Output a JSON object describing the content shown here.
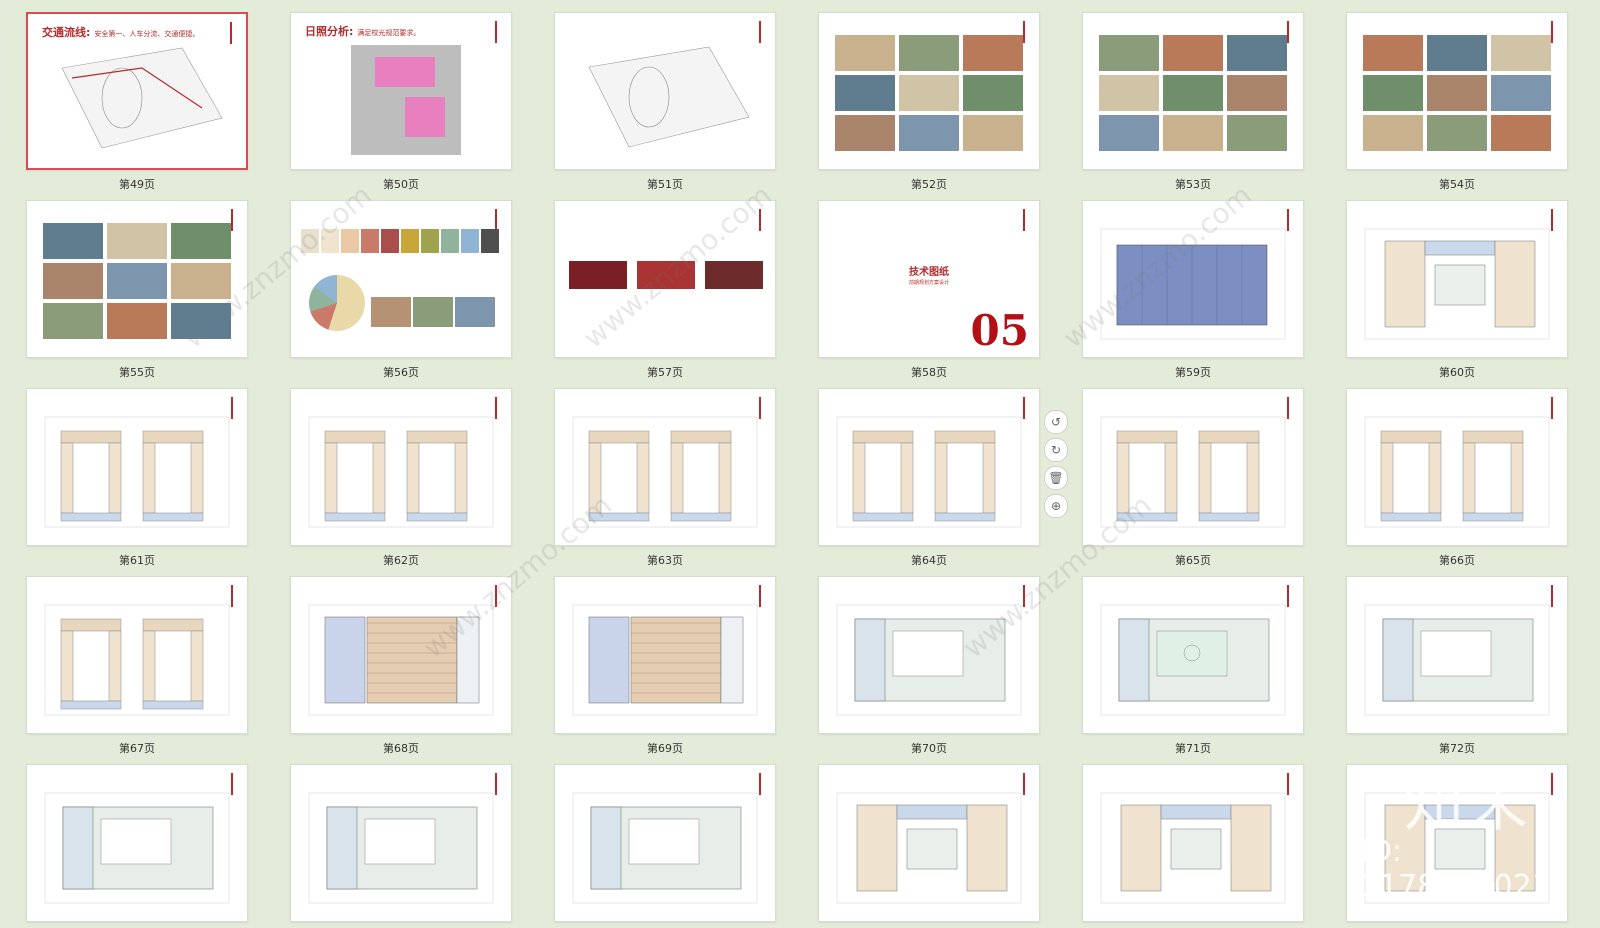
{
  "pages": [
    {
      "label": "第49页",
      "kind": "traffic",
      "title": "交通流线:",
      "subtitle": "安全第一、人车分流、交通便捷。",
      "selected": true
    },
    {
      "label": "第50页",
      "kind": "sun",
      "title": "日照分析:",
      "subtitle": "满足校光规范要求。"
    },
    {
      "label": "第51页",
      "kind": "site"
    },
    {
      "label": "第52页",
      "kind": "photos"
    },
    {
      "label": "第53页",
      "kind": "photos"
    },
    {
      "label": "第54页",
      "kind": "island"
    },
    {
      "label": "第55页",
      "kind": "photos"
    },
    {
      "label": "第56页",
      "kind": "colors"
    },
    {
      "label": "第57页",
      "kind": "diagram"
    },
    {
      "label": "第58页",
      "kind": "cover",
      "heading": "技术图纸",
      "subheading": "前期规划方案设计",
      "number": "05"
    },
    {
      "label": "第59页",
      "kind": "plan-blue"
    },
    {
      "label": "第60页",
      "kind": "plan"
    },
    {
      "label": "第61页",
      "kind": "plan-u"
    },
    {
      "label": "第62页",
      "kind": "plan-u"
    },
    {
      "label": "第63页",
      "kind": "plan-u"
    },
    {
      "label": "第64页",
      "kind": "plan-u"
    },
    {
      "label": "第65页",
      "kind": "plan-u"
    },
    {
      "label": "第66页",
      "kind": "plan-u"
    },
    {
      "label": "第67页",
      "kind": "plan-u"
    },
    {
      "label": "第68页",
      "kind": "plan-hall"
    },
    {
      "label": "第69页",
      "kind": "plan-hall"
    },
    {
      "label": "第70页",
      "kind": "plan-grey"
    },
    {
      "label": "第71页",
      "kind": "plan-court"
    },
    {
      "label": "第72页",
      "kind": "plan-grey"
    },
    {
      "label": "",
      "kind": "plan-grey"
    },
    {
      "label": "",
      "kind": "plan-grey"
    },
    {
      "label": "",
      "kind": "plan-grey"
    },
    {
      "label": "",
      "kind": "plan"
    },
    {
      "label": "",
      "kind": "plan"
    },
    {
      "label": "",
      "kind": "plan"
    }
  ],
  "toolbar": {
    "rotate_left": "↺",
    "rotate_right": "↻",
    "delete": "🗑",
    "add": "⊕"
  },
  "watermark": {
    "url": "www.znzmo.com",
    "logo": "知末",
    "id": "ID: 1178798021"
  },
  "colors": {
    "accent": "#b52b2b",
    "background": "#e3ecd9",
    "selected_border": "#d94b55"
  },
  "swatches": [
    "#e9e0cf",
    "#f0e4cf",
    "#eac9a4",
    "#c97a6a",
    "#a94d4d",
    "#c8a63a",
    "#a0a34d",
    "#8fb39c",
    "#8fb4d4",
    "#4f4f4f"
  ]
}
